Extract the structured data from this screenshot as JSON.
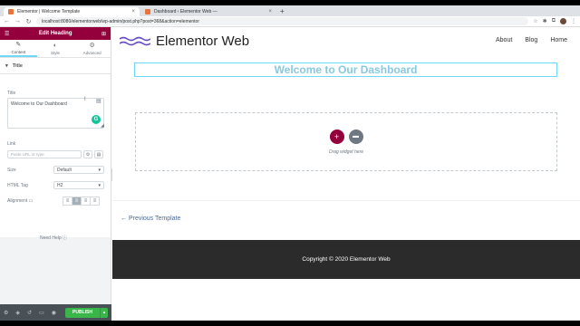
{
  "browser": {
    "tabs": [
      {
        "title": "Elementor | Welcome Template",
        "active": true
      },
      {
        "title": "Dashboard ‹ Elementor Web —",
        "active": false
      }
    ],
    "new_tab": "+",
    "url": "localhost:8080/elementorweb/wp-admin/post.php?post=368&action=elementor"
  },
  "panel": {
    "title": "Edit Heading",
    "tabs": [
      {
        "label": "Content",
        "icon": "pencil-icon",
        "active": true
      },
      {
        "label": "Style",
        "icon": "half-circle-icon",
        "active": false
      },
      {
        "label": "Advanced",
        "icon": "gear-icon",
        "active": false
      }
    ],
    "section_title": "Title",
    "title_label": "Title",
    "title_value": "Welcome to Our Dashboard",
    "link_label": "Link",
    "link_placeholder": "Paste URL or type",
    "size_label": "Size",
    "size_value": "Default",
    "html_tag_label": "HTML Tag",
    "html_tag_value": "H2",
    "alignment_label": "Alignment",
    "alignment_options": [
      "left",
      "center",
      "right",
      "justify"
    ],
    "alignment_selected": "center",
    "need_help": "Need Help",
    "publish_label": "PUBLISH"
  },
  "site": {
    "logo_text": "Elementor Web",
    "menu": [
      "About",
      "Blog",
      "Home"
    ],
    "heading": "Welcome to Our Dashboard",
    "drop_text": "Drag widget here",
    "prev_link": "← Previous Template",
    "copyright": "Copyright © 2020 Elementor Web"
  },
  "colors": {
    "brand": "#93003c",
    "accent": "#71d7f7",
    "publish": "#39b54a",
    "footer": "#2b2b2b"
  }
}
